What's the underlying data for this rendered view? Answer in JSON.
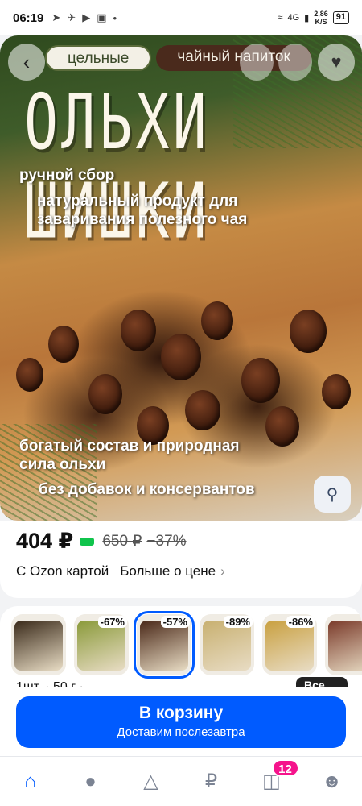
{
  "status_bar": {
    "time": "06:19",
    "network": "4G",
    "speed_value": "2,86",
    "speed_unit": "K/S",
    "battery": "91"
  },
  "hero": {
    "tags": [
      "цельные",
      "чайный напиток"
    ],
    "title": "ОЛЬХИ ШИШКИ",
    "line1": "ручной сбор",
    "line2": "натуральный продукт для заваривания полезного чая",
    "line3": "богатый состав и природная сила ольхи",
    "line4": "без добавок и консервантов"
  },
  "price": {
    "current": "404 ₽",
    "old": "650 ₽",
    "discount": "−37%",
    "ozon_card_label": "С Ozon картой",
    "more_label": "Больше о цене"
  },
  "variants": [
    {
      "discount": "",
      "color": "#3a2a1a"
    },
    {
      "discount": "-67%",
      "color": "#8a9a3a"
    },
    {
      "discount": "-57%",
      "color": "#4a2818"
    },
    {
      "discount": "-89%",
      "color": "#c8b070"
    },
    {
      "discount": "-86%",
      "color": "#c9a040"
    },
    {
      "discount": "",
      "color": "#7a3a2a"
    }
  ],
  "unit_line": "1шт. · 50 г ·",
  "all_button": "Все",
  "cart": {
    "label": "В корзину",
    "sublabel": "Доставим послезавтра"
  },
  "tabbar": {
    "cart_badge": "12"
  },
  "colors": {
    "accent": "#005bff",
    "badge": "#f5148c",
    "ozon_green": "#10c44c"
  }
}
